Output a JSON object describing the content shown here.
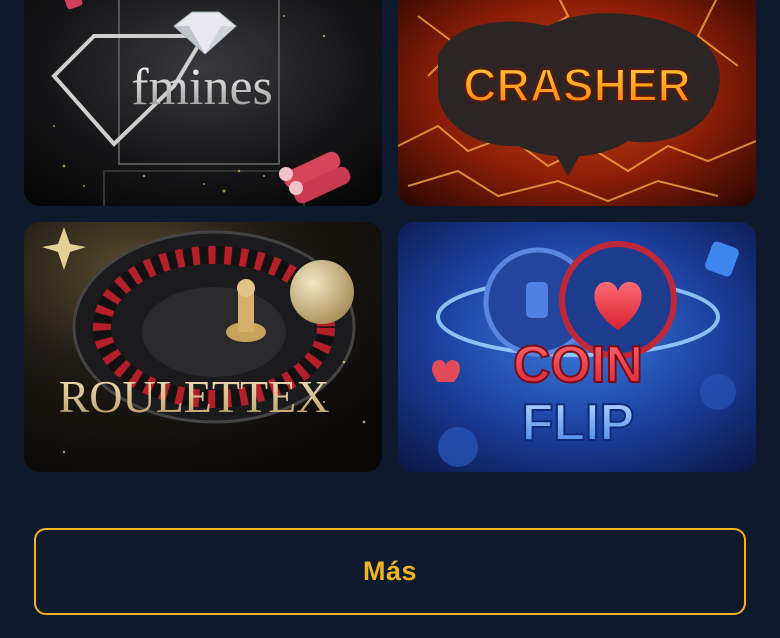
{
  "games": [
    {
      "id": "fmines",
      "label": "fmines",
      "icon": "diamond-icon"
    },
    {
      "id": "crasher",
      "label": "CRASHER",
      "icon": "lava-icon"
    },
    {
      "id": "roulette",
      "label": "ROULETTEX",
      "icon": "roulette-wheel-icon"
    },
    {
      "id": "coinflip",
      "label_line1": "COIN",
      "label_line2": "FLIP",
      "icon": "heart-coin-icon"
    }
  ],
  "more_button": {
    "label": "Más"
  },
  "colors": {
    "background": "#0e1a2b",
    "accent": "#f2b321"
  }
}
